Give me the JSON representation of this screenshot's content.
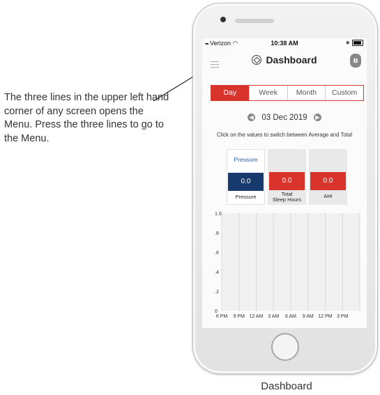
{
  "annotation": {
    "text": "The three lines in the upper left hand corner of any screen opens the Menu. Press the three lines to go to the Menu."
  },
  "statusbar": {
    "carrier": "Verizon",
    "time": "10:38 AM",
    "bluetooth_glyph": "∗"
  },
  "header": {
    "title": "Dashboard",
    "bt_glyph": "ʙ"
  },
  "tabs": [
    "Day",
    "Week",
    "Month",
    "Custom"
  ],
  "active_tab": "Day",
  "date": {
    "value": "03 Dec 2019",
    "prev_glyph": "◀",
    "next_glyph": "▶"
  },
  "hint": "Click on the values to switch between Average and Total",
  "cards": [
    {
      "selector": "Pressure",
      "value": "0.0",
      "label": "Pressure",
      "color": "#173a6e"
    },
    {
      "selector": "",
      "value": "0.0",
      "label_line1": "Total",
      "label_line2": "Sleep Hours",
      "color": "#d9342c"
    },
    {
      "selector": "",
      "value": "0.0",
      "label": "AHI",
      "color": "#d9342c"
    }
  ],
  "chart_data": {
    "type": "bar",
    "y_ticks": [
      "1.0",
      ".8",
      ".6",
      ".4",
      ".2",
      "0"
    ],
    "categories": [
      "6 PM",
      "9 PM",
      "12 AM",
      "3 AM",
      "6 AM",
      "9 AM",
      "12 PM",
      "3 PM"
    ],
    "values": [
      0,
      0,
      0,
      0,
      0,
      0,
      0,
      0
    ],
    "ylim": [
      0,
      1.0
    ],
    "grid": true
  },
  "caption": "Dashboard",
  "colors": {
    "accent": "#d9342c",
    "pressure_blue": "#173a6e",
    "link_blue": "#2d5fa5"
  }
}
